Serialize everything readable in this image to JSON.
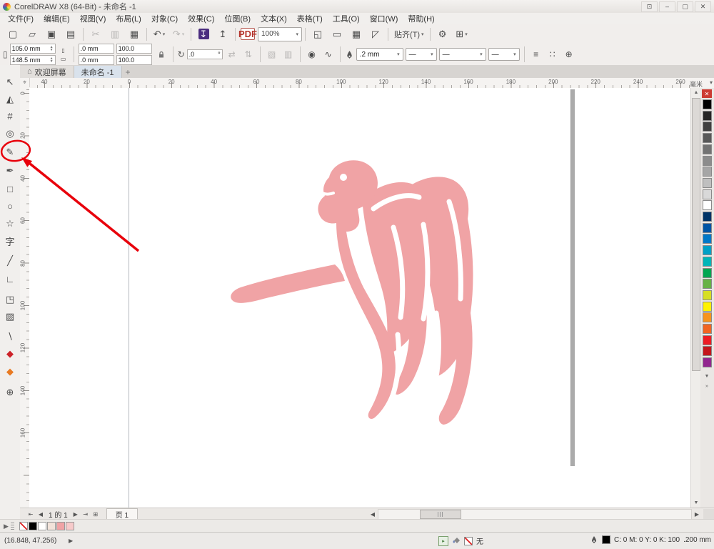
{
  "window": {
    "title": "CorelDRAW X8 (64-Bit) - 未命名 -1",
    "controls": [
      {
        "name": "titlebar-extra-button",
        "glyph": "⊡"
      },
      {
        "name": "minimize-button",
        "glyph": "–"
      },
      {
        "name": "maximize-button",
        "glyph": "▢"
      },
      {
        "name": "close-button",
        "glyph": "✕"
      }
    ]
  },
  "menu_items": [
    "文件(F)",
    "编辑(E)",
    "视图(V)",
    "布局(L)",
    "对象(C)",
    "效果(C)",
    "位图(B)",
    "文本(X)",
    "表格(T)",
    "工具(O)",
    "窗口(W)",
    "帮助(H)"
  ],
  "standard_toolbar": [
    {
      "name": "new-document-button",
      "glyph": "▢"
    },
    {
      "name": "open-button",
      "glyph": "▱"
    },
    {
      "name": "save-button",
      "glyph": "▣"
    },
    {
      "name": "print-button",
      "glyph": "▤"
    },
    {
      "type": "sep"
    },
    {
      "name": "cut-button",
      "glyph": "✂",
      "disabled": true
    },
    {
      "name": "copy-button",
      "glyph": "▥",
      "disabled": true
    },
    {
      "name": "paste-button",
      "glyph": "▦"
    },
    {
      "type": "sep"
    },
    {
      "name": "undo-button",
      "glyph": "↶",
      "dropdown": true
    },
    {
      "name": "redo-button",
      "glyph": "↷",
      "dropdown": true,
      "disabled": true
    },
    {
      "type": "sep"
    },
    {
      "name": "import-button",
      "glyph": "↧",
      "bg": "#4b2d7f"
    },
    {
      "name": "export-button",
      "glyph": "↥"
    },
    {
      "type": "sep"
    },
    {
      "name": "publish-pdf-button",
      "text": "PDF",
      "pdf": true
    },
    {
      "name": "zoom-level-combo",
      "type": "combo",
      "value": "100%"
    },
    {
      "type": "sep"
    },
    {
      "name": "fullscreen-preview-button",
      "glyph": "◱"
    },
    {
      "name": "show-rulers-button",
      "glyph": "▭"
    },
    {
      "name": "show-grid-button",
      "glyph": "▦"
    },
    {
      "name": "show-guidelines-button",
      "glyph": "◸"
    },
    {
      "type": "sep"
    },
    {
      "name": "snap-to-dropdown",
      "type": "textdd",
      "label": "贴齐(T)"
    },
    {
      "type": "sep"
    },
    {
      "name": "options-button",
      "glyph": "⚙"
    },
    {
      "name": "launcher-dropdown",
      "glyph": "⊞",
      "dropdown": true
    }
  ],
  "property_bar": {
    "page_width": "105.0 mm",
    "page_height": "148.5 mm",
    "pos_x": ".0 mm",
    "pos_y": ".0 mm",
    "scale_h": "100.0",
    "scale_v": "100.0",
    "angle": ".0",
    "outline_width": ".2 mm"
  },
  "doc_tabs": {
    "welcome": "欢迎屏幕",
    "document": "未命名 -1"
  },
  "ruler": {
    "h_labels": [
      "40",
      "20",
      "0",
      "20",
      "40",
      "60",
      "80",
      "100",
      "120",
      "140",
      "160",
      "180",
      "200",
      "220",
      "240",
      "260"
    ],
    "v_labels": [
      "0",
      "20",
      "40",
      "60",
      "80",
      "100",
      "120",
      "140",
      "160"
    ],
    "unit_label": "毫米"
  },
  "toolbox_tools": [
    {
      "name": "pick-tool",
      "glyph": "↖"
    },
    {
      "name": "shape-tool",
      "glyph": "◭"
    },
    {
      "name": "crop-tool",
      "glyph": "#"
    },
    {
      "name": "zoom-tool",
      "glyph": "◎"
    },
    {
      "name": "freehand-tool",
      "glyph": "✎"
    },
    {
      "name": "artistic-media-tool",
      "glyph": "✒"
    },
    {
      "name": "rectangle-tool",
      "glyph": "□"
    },
    {
      "name": "ellipse-tool",
      "glyph": "○"
    },
    {
      "name": "polygon-tool",
      "glyph": "☆"
    },
    {
      "name": "text-tool",
      "glyph": "字"
    },
    {
      "name": "parallel-dimension-tool",
      "glyph": "╱"
    },
    {
      "name": "connector-tool",
      "glyph": "∟"
    },
    {
      "name": "drop-shadow-tool",
      "glyph": "◳"
    },
    {
      "name": "transparency-tool",
      "glyph": "▨"
    },
    {
      "name": "color-eyedropper-tool",
      "glyph": "∖"
    },
    {
      "name": "interactive-fill-tool",
      "glyph": "◆",
      "color": "#cc2229"
    },
    {
      "name": "smart-fill-tool",
      "glyph": "◆",
      "color": "#e87a22"
    },
    {
      "name": "customize-toolbox-button",
      "glyph": "⊕"
    }
  ],
  "palette": {
    "colors": [
      "#000000",
      "#262626",
      "#404040",
      "#595959",
      "#737373",
      "#8c8c8c",
      "#a6a6a6",
      "#bfbfbf",
      "#d9d9d9",
      "#ffffff",
      "#003366",
      "#0055a5",
      "#0078c8",
      "#00a0c6",
      "#00b5b8",
      "#00a651",
      "#66b245",
      "#d7df23",
      "#fff200",
      "#f7941d",
      "#f26522",
      "#ed1c24",
      "#c4161c",
      "#92278f"
    ]
  },
  "document_palette": {
    "colors": [
      "none",
      "#000000",
      "#ffffff",
      "#f2e3da",
      "#f0a3a5",
      "#f7caca"
    ]
  },
  "page_nav": {
    "buttons_left": [
      {
        "name": "first-page-button",
        "glyph": "⇤"
      },
      {
        "name": "prev-page-button",
        "glyph": "◀"
      }
    ],
    "info": "1 的 1",
    "buttons_right": [
      {
        "name": "next-page-button",
        "glyph": "▶"
      },
      {
        "name": "last-page-button",
        "glyph": "⇥"
      },
      {
        "name": "add-page-button",
        "glyph": "⊞"
      }
    ],
    "page_tab": "页 1"
  },
  "status_bar": {
    "coords": "(16.848, 47.256)",
    "expander_glyph": "▶",
    "fill_label": "无",
    "outline_cmyk": "C: 0 M: 0 Y: 0 K: 100",
    "outline_width": ".200 mm"
  },
  "icons": {
    "home": "⌂",
    "plus": "+",
    "dropdown": "▾",
    "scroll_up": "▲",
    "scroll_down": "▼",
    "scroll_left": "◀",
    "scroll_right": "▶",
    "close": "✕",
    "corner": "⌖",
    "flyout": "»",
    "page_size": "▯",
    "portrait": "▯",
    "landscape": "▭",
    "rotate": "↻",
    "degree": "°",
    "mirror_h": "⇄",
    "mirror_v": "⇅",
    "obj_a": "▧",
    "obj_b": "▥",
    "node_a": "◉",
    "node_b": "∿",
    "wrap": "≡",
    "snap_grid": "∷",
    "align": "⊕",
    "line": "—"
  },
  "artwork": {
    "name": "pink-angel-clipart",
    "fill": "#f0a3a5"
  },
  "annotation": {
    "color": "#e8000b"
  }
}
